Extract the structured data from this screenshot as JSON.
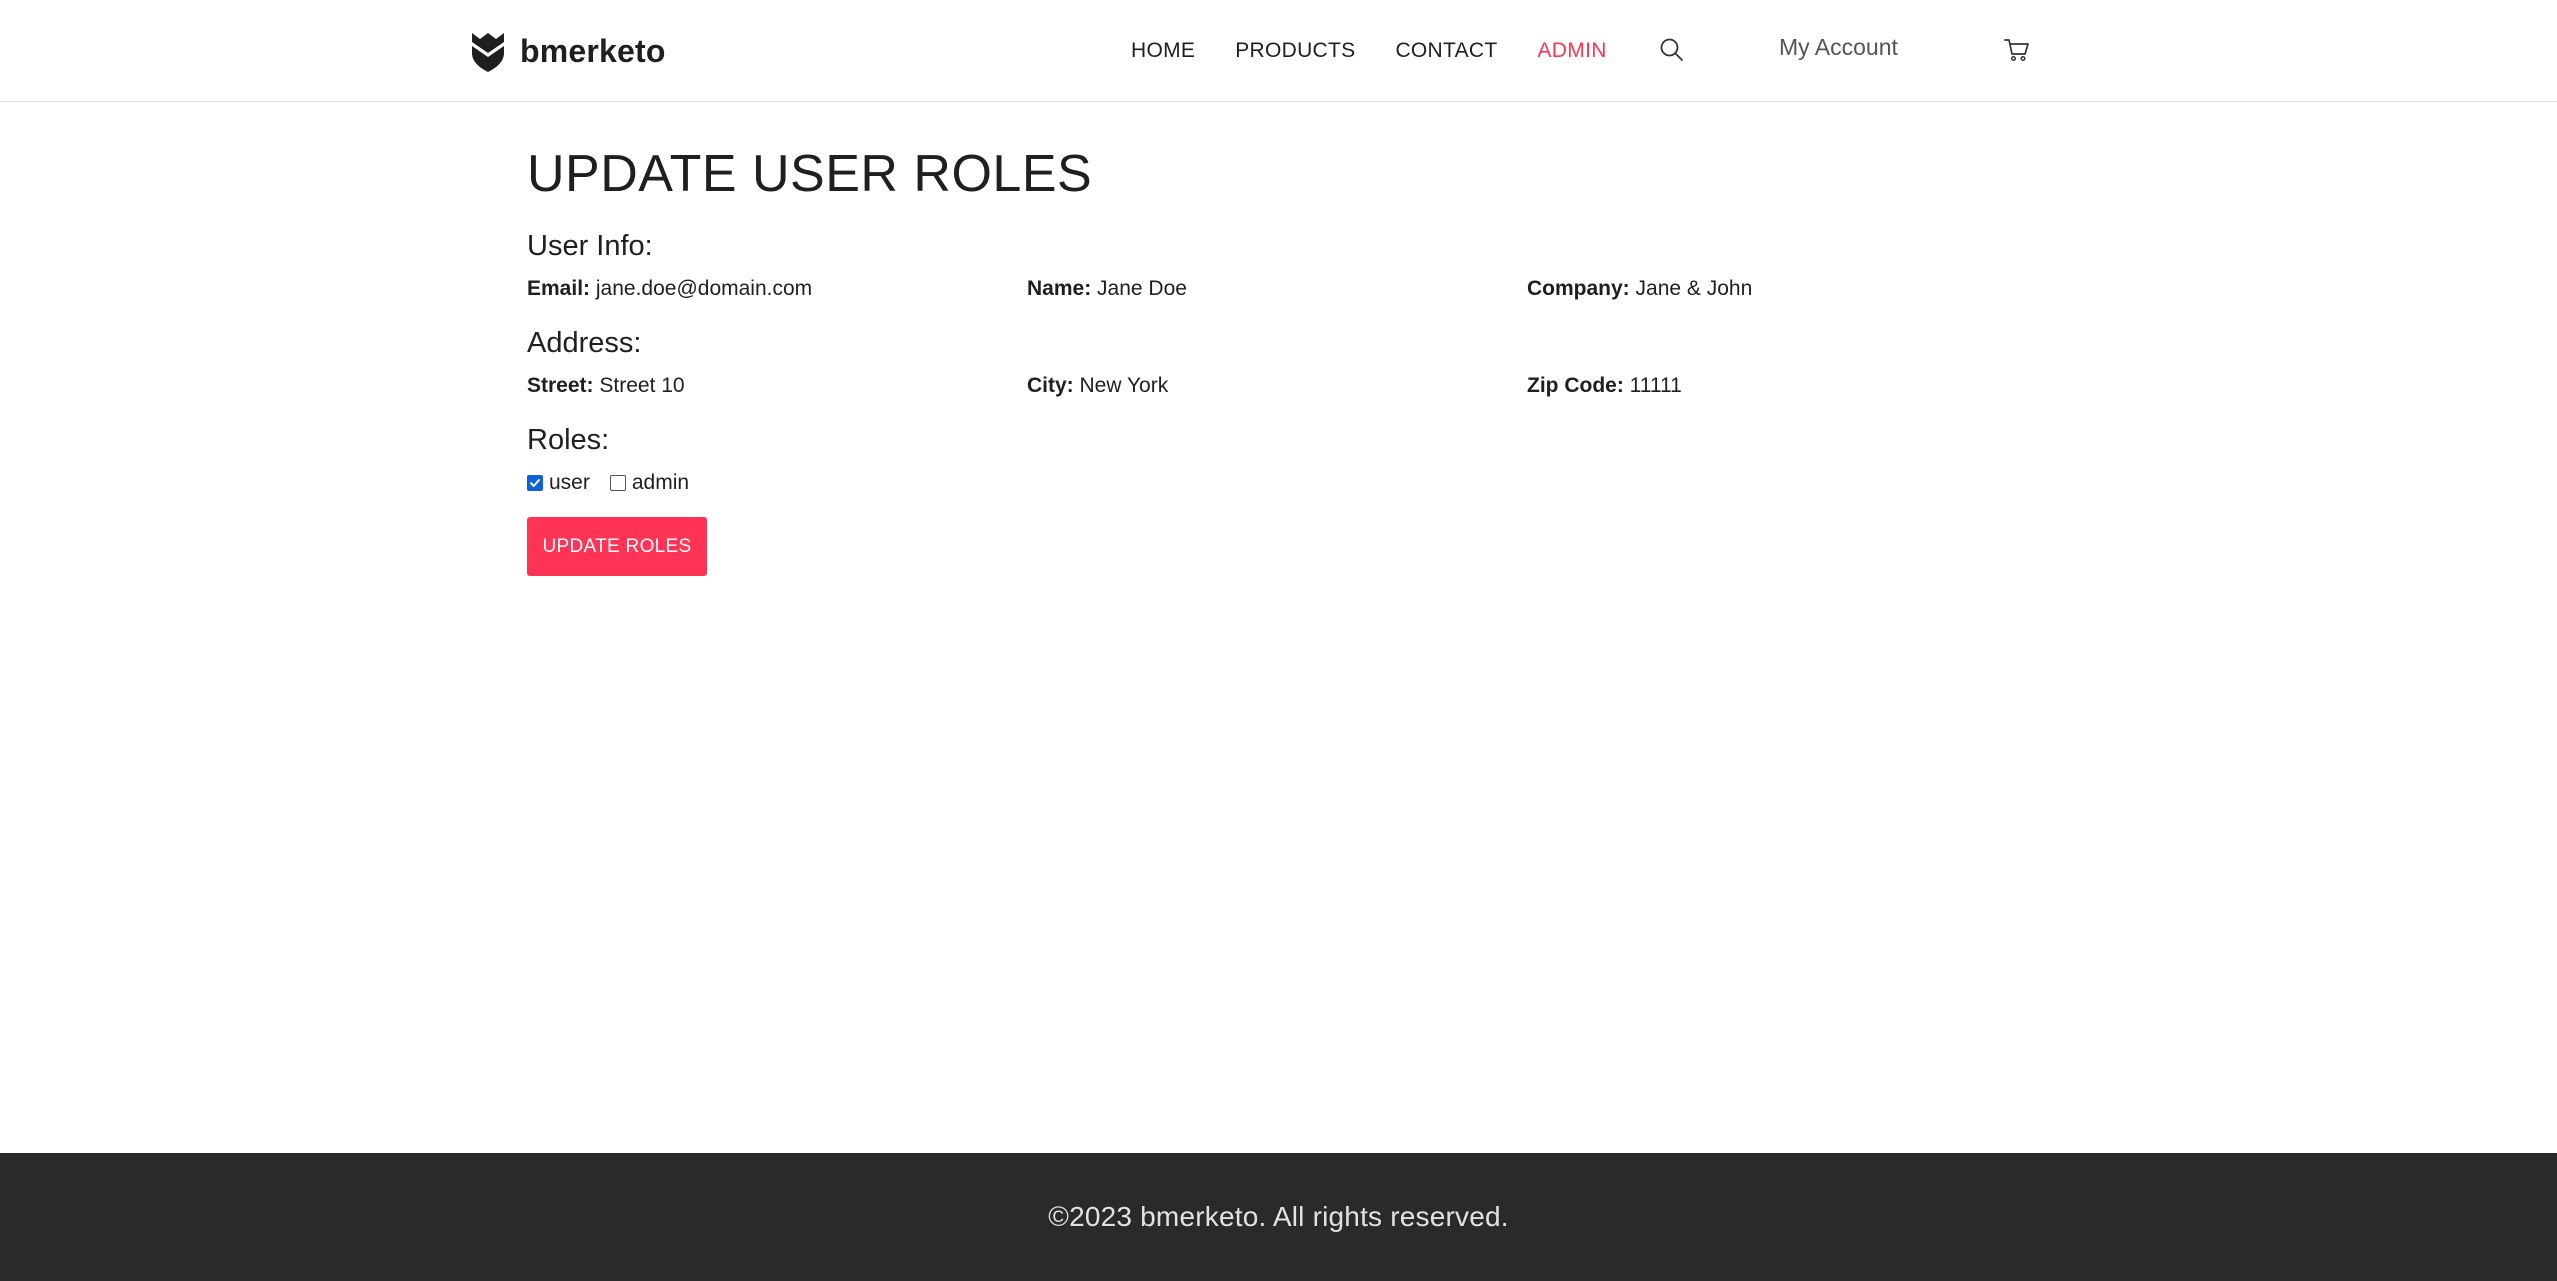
{
  "header": {
    "brand_name": "bmerketo",
    "logo_icon": "shield-logo",
    "nav": [
      {
        "label": "HOME",
        "active": false
      },
      {
        "label": "PRODUCTS",
        "active": false
      },
      {
        "label": "CONTACT",
        "active": false
      },
      {
        "label": "ADMIN",
        "active": true
      }
    ],
    "search_icon": "search-icon",
    "account_label": "My Account",
    "cart_icon": "cart-icon"
  },
  "main": {
    "title": "UPDATE USER ROLES",
    "user_info": {
      "heading": "User Info:",
      "email_label": "Email:",
      "email_value": "jane.doe@domain.com",
      "name_label": "Name:",
      "name_value": "Jane Doe",
      "company_label": "Company:",
      "company_value": "Jane & John"
    },
    "address": {
      "heading": "Address:",
      "street_label": "Street:",
      "street_value": "Street 10",
      "city_label": "City:",
      "city_value": "New York",
      "zip_label": "Zip Code:",
      "zip_value": "11111"
    },
    "roles": {
      "heading": "Roles:",
      "items": [
        {
          "label": "user",
          "checked": true
        },
        {
          "label": "admin",
          "checked": false
        }
      ]
    },
    "submit_label": "UPDATE ROLES"
  },
  "footer": {
    "text": "©2023 bmerketo. All rights reserved."
  },
  "colors": {
    "accent": "#ff3355",
    "footer_bg": "#2a2a2a",
    "checkbox_checked": "#0b63d6",
    "text": "#1f1f1f"
  }
}
